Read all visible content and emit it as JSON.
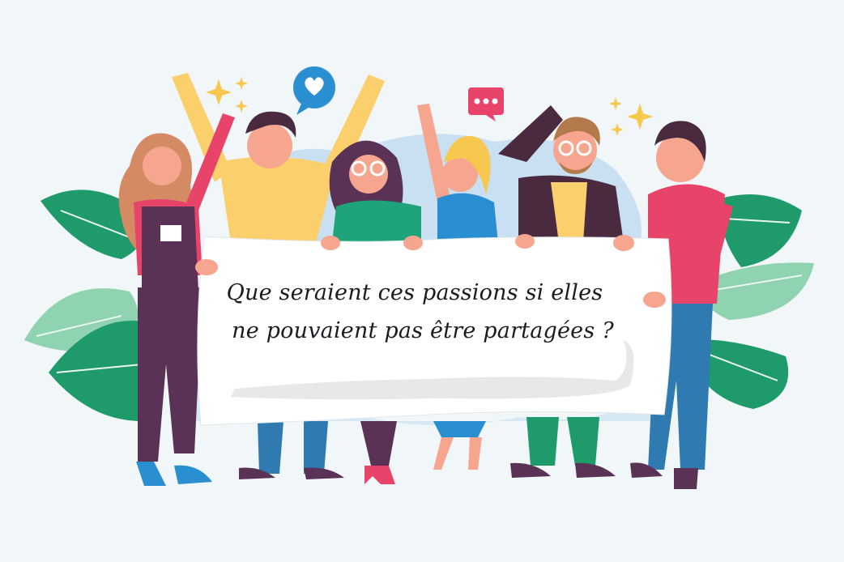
{
  "banner": {
    "line1": "Que seraient ces passions si elles",
    "line2": "ne pouvaient pas être partagées ?"
  },
  "colors": {
    "background": "#f1f6f9",
    "leaf_dark": "#1f9a6a",
    "leaf_light": "#8fd3b0",
    "blob": "#c9e0f3",
    "banner": "#ffffff",
    "accent_pink": "#e8446a",
    "accent_yellow": "#f7c84f",
    "accent_purple": "#5a3255"
  },
  "icons": [
    "heart-speech-bubble-icon",
    "ellipsis-speech-bubble-icon",
    "sparkle-icon"
  ]
}
